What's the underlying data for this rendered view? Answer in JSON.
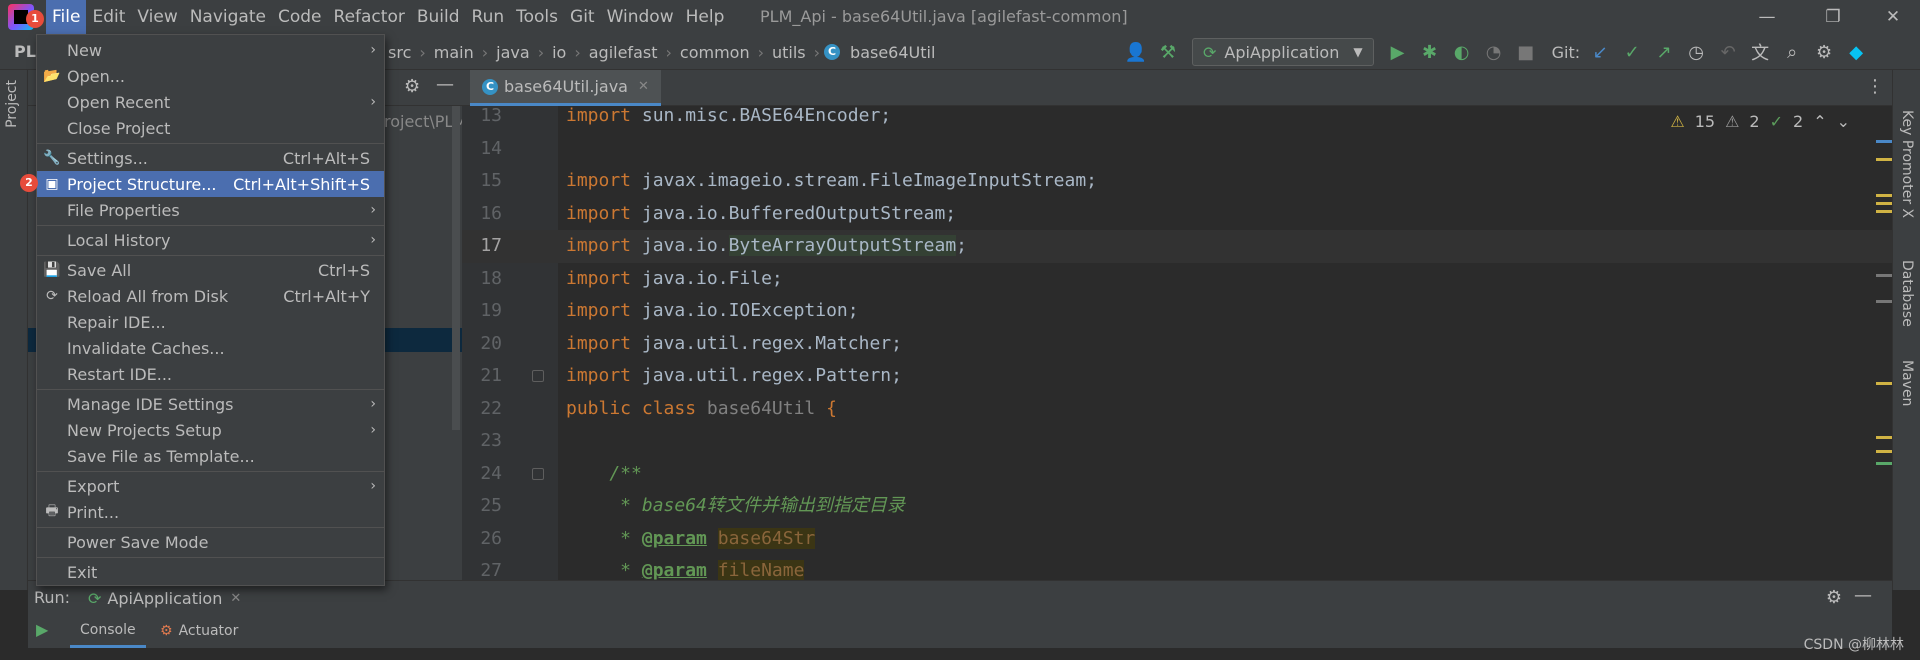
{
  "window": {
    "title": "PLM_Api - base64Util.java [agilefast-common]",
    "minimize": "—",
    "restore": "❐",
    "close": "✕"
  },
  "menubar": [
    "File",
    "Edit",
    "View",
    "Navigate",
    "Code",
    "Refactor",
    "Build",
    "Run",
    "Tools",
    "Git",
    "Window",
    "Help"
  ],
  "badges": {
    "first": "1",
    "second": "2"
  },
  "navbar": {
    "project_short": "PLI",
    "breadcrumb": [
      "src",
      "main",
      "java",
      "io",
      "agilefast",
      "common",
      "utils"
    ],
    "class_name": "base64Util",
    "run_config": "ApiApplication",
    "git_label": "Git:"
  },
  "project_panel": {
    "tab_label": "Project",
    "path_fragment": "roject\\PLM"
  },
  "editor": {
    "tab_label": "base64Util.java",
    "inspections": {
      "warnings": "15",
      "weak": "2",
      "ok": "2"
    },
    "lines": [
      {
        "n": "13",
        "kw": "import",
        "rest": " sun.misc.BASE64Encoder;"
      },
      {
        "n": "14",
        "kw": "",
        "rest": ""
      },
      {
        "n": "15",
        "kw": "import",
        "rest": " javax.imageio.stream.FileImageInputStream;"
      },
      {
        "n": "16",
        "kw": "import",
        "rest": " java.io.BufferedOutputStream;"
      },
      {
        "n": "17",
        "kw": "import",
        "pre": " java.io.",
        "hl": "ByteArrayOutputStream",
        "rest": ";"
      },
      {
        "n": "18",
        "kw": "import",
        "rest": " java.io.File;"
      },
      {
        "n": "19",
        "kw": "import",
        "rest": " java.io.IOException;"
      },
      {
        "n": "20",
        "kw": "import",
        "rest": " java.util.regex.Matcher;"
      },
      {
        "n": "21",
        "kw": "import",
        "rest": " java.util.regex.Pattern;"
      },
      {
        "n": "22",
        "kw": "public class",
        "cls": " base64Util ",
        "rest": "{"
      },
      {
        "n": "23",
        "kw": "",
        "rest": ""
      },
      {
        "n": "24",
        "doc": "    /**"
      },
      {
        "n": "25",
        "doc": "     * base64转文件并输出到指定目录"
      },
      {
        "n": "26",
        "doc_pre": "     * ",
        "tag": "@param",
        "param": "base64Str"
      },
      {
        "n": "27",
        "doc_pre": "     * ",
        "tag": "@param",
        "param": "fileName"
      }
    ]
  },
  "right_strip": [
    "Key Promoter X",
    "Database",
    "Maven"
  ],
  "run_panel": {
    "label": "Run:",
    "config": "ApiApplication",
    "tabs": [
      "Console",
      "Actuator"
    ]
  },
  "watermark": "CSDN @柳林林",
  "file_menu": [
    {
      "label": "New",
      "short": "",
      "arrow": true,
      "icon": ""
    },
    {
      "label": "Open...",
      "short": "",
      "arrow": false,
      "icon": "folder-icon"
    },
    {
      "label": "Open Recent",
      "short": "",
      "arrow": true,
      "icon": ""
    },
    {
      "label": "Close Project",
      "short": "",
      "arrow": false,
      "icon": ""
    },
    {
      "sep": true
    },
    {
      "label": "Settings...",
      "short": "Ctrl+Alt+S",
      "arrow": false,
      "icon": "wrench-icon"
    },
    {
      "label": "Project Structure...",
      "short": "Ctrl+Alt+Shift+S",
      "arrow": false,
      "icon": "project-structure-icon",
      "selected": true
    },
    {
      "label": "File Properties",
      "short": "",
      "arrow": true,
      "icon": ""
    },
    {
      "sep": true
    },
    {
      "label": "Local History",
      "short": "",
      "arrow": true,
      "icon": ""
    },
    {
      "sep": true
    },
    {
      "label": "Save All",
      "short": "Ctrl+S",
      "arrow": false,
      "icon": "save-icon"
    },
    {
      "label": "Reload All from Disk",
      "short": "Ctrl+Alt+Y",
      "arrow": false,
      "icon": "reload-icon"
    },
    {
      "label": "Repair IDE...",
      "short": "",
      "arrow": false,
      "icon": ""
    },
    {
      "label": "Invalidate Caches...",
      "short": "",
      "arrow": false,
      "icon": ""
    },
    {
      "label": "Restart IDE...",
      "short": "",
      "arrow": false,
      "icon": ""
    },
    {
      "sep": true
    },
    {
      "label": "Manage IDE Settings",
      "short": "",
      "arrow": true,
      "icon": ""
    },
    {
      "label": "New Projects Setup",
      "short": "",
      "arrow": true,
      "icon": ""
    },
    {
      "label": "Save File as Template...",
      "short": "",
      "arrow": false,
      "icon": ""
    },
    {
      "sep": true
    },
    {
      "label": "Export",
      "short": "",
      "arrow": true,
      "icon": ""
    },
    {
      "label": "Print...",
      "short": "",
      "arrow": false,
      "icon": "print-icon"
    },
    {
      "sep": true
    },
    {
      "label": "Power Save Mode",
      "short": "",
      "arrow": false,
      "icon": ""
    },
    {
      "sep": true
    },
    {
      "label": "Exit",
      "short": "",
      "arrow": false,
      "icon": ""
    }
  ],
  "colors": {
    "accent": "#4b6eaf",
    "badge": "#e74c3c",
    "keyword": "#cc7832",
    "doc": "#629755"
  }
}
